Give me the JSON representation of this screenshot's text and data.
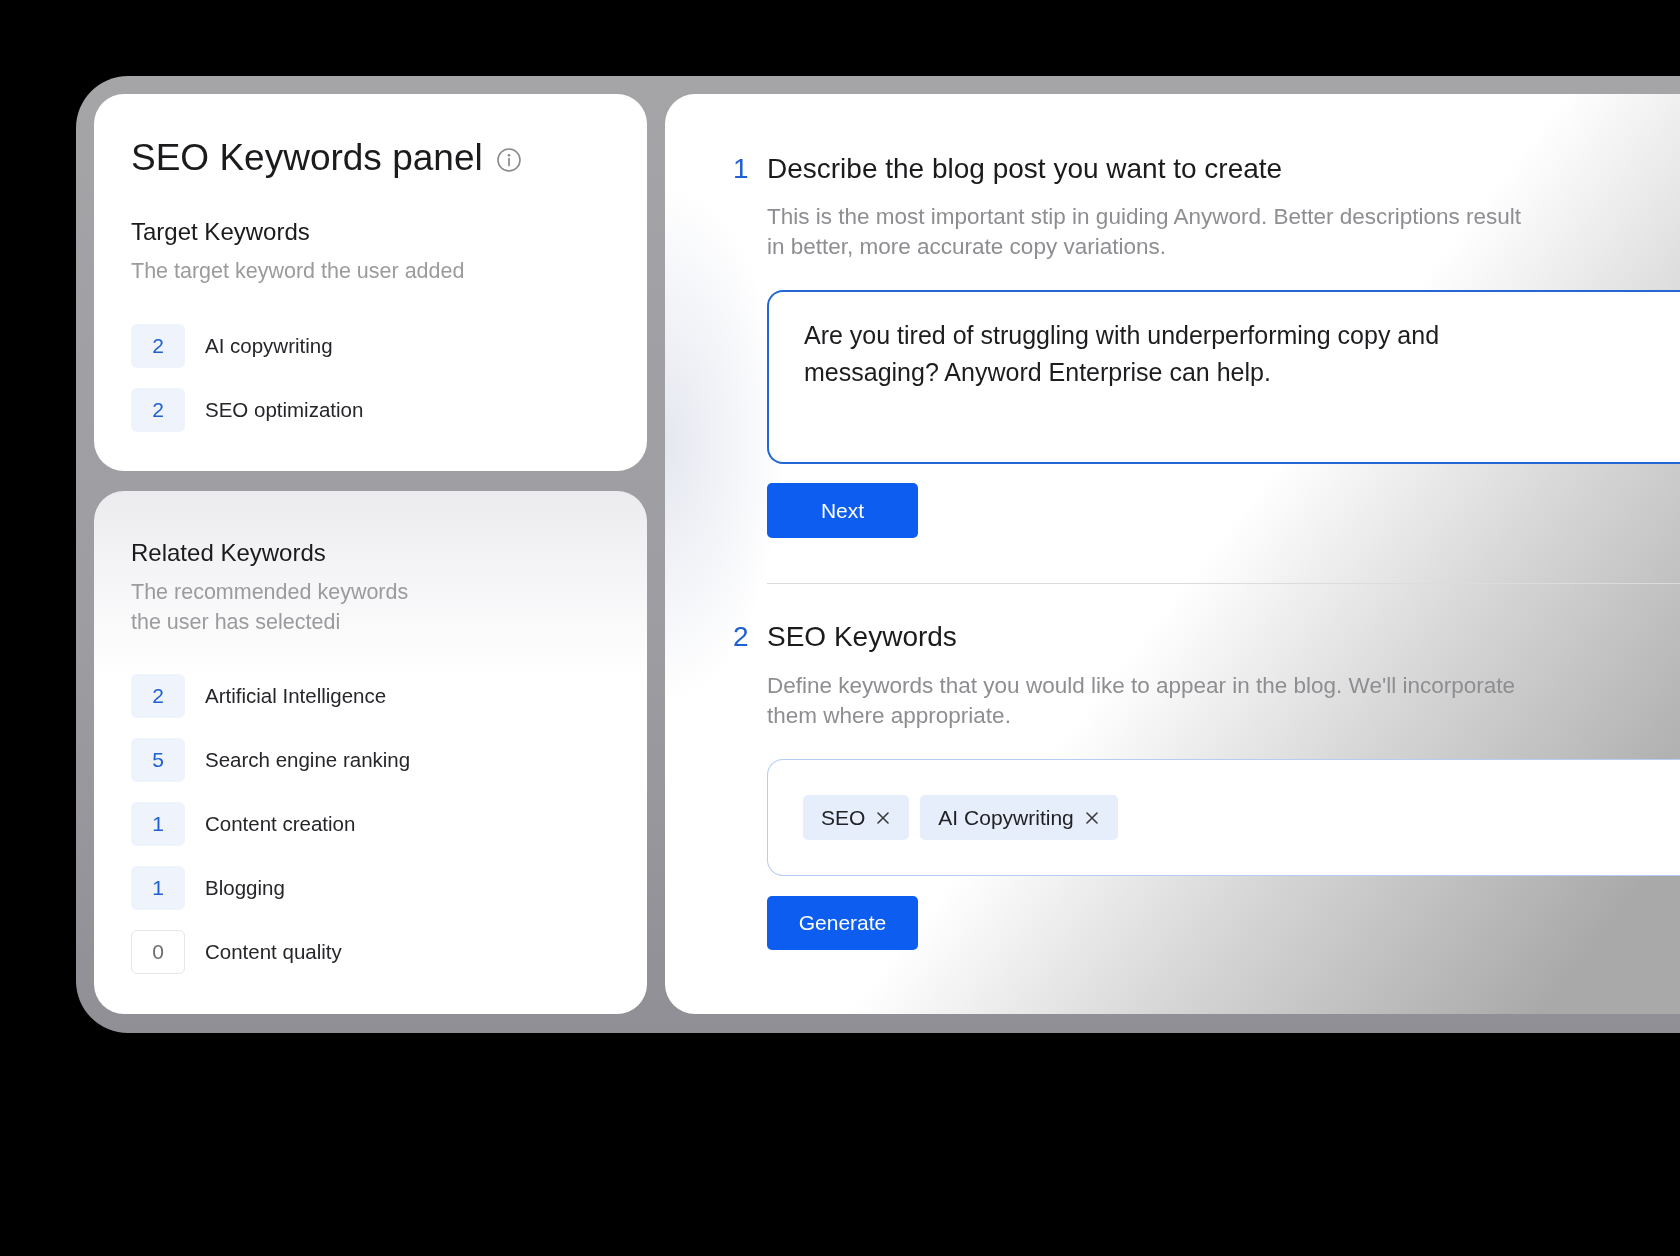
{
  "sidebar": {
    "title": "SEO Keywords panel",
    "target_keywords": {
      "title": "Target Keywords",
      "subtitle": "The target keyword the user added",
      "items": [
        {
          "count": "2",
          "label": "AI copywriting",
          "active": true
        },
        {
          "count": "2",
          "label": "SEO optimization",
          "active": true
        }
      ]
    },
    "related_keywords": {
      "title": "Related Keywords",
      "subtitle": "The recommended keywords the user has selectedi",
      "items": [
        {
          "count": "2",
          "label": "Artificial Intelligence",
          "active": true
        },
        {
          "count": "5",
          "label": "Search engine ranking",
          "active": true
        },
        {
          "count": "1",
          "label": "Content creation",
          "active": true
        },
        {
          "count": "1",
          "label": "Blogging",
          "active": true
        },
        {
          "count": "0",
          "label": "Content quality",
          "active": false
        }
      ]
    }
  },
  "steps": [
    {
      "number": "1",
      "title": "Describe the blog post you want to create",
      "description": "This is the most important stip in guiding Anyword. Better descriptions result in better, more accurate copy variations.",
      "kind": "text",
      "value": "Are you tired of struggling with underperforming copy and messaging? Anyword Enterprise can help.",
      "button": "Next"
    },
    {
      "number": "2",
      "title": "SEO Keywords",
      "description": "Define keywords that you would like to appear in the blog. We'll incorporate them where appropriate.",
      "kind": "tags",
      "tags": [
        "SEO",
        "AI Copywriting"
      ],
      "button": "Generate"
    }
  ]
}
